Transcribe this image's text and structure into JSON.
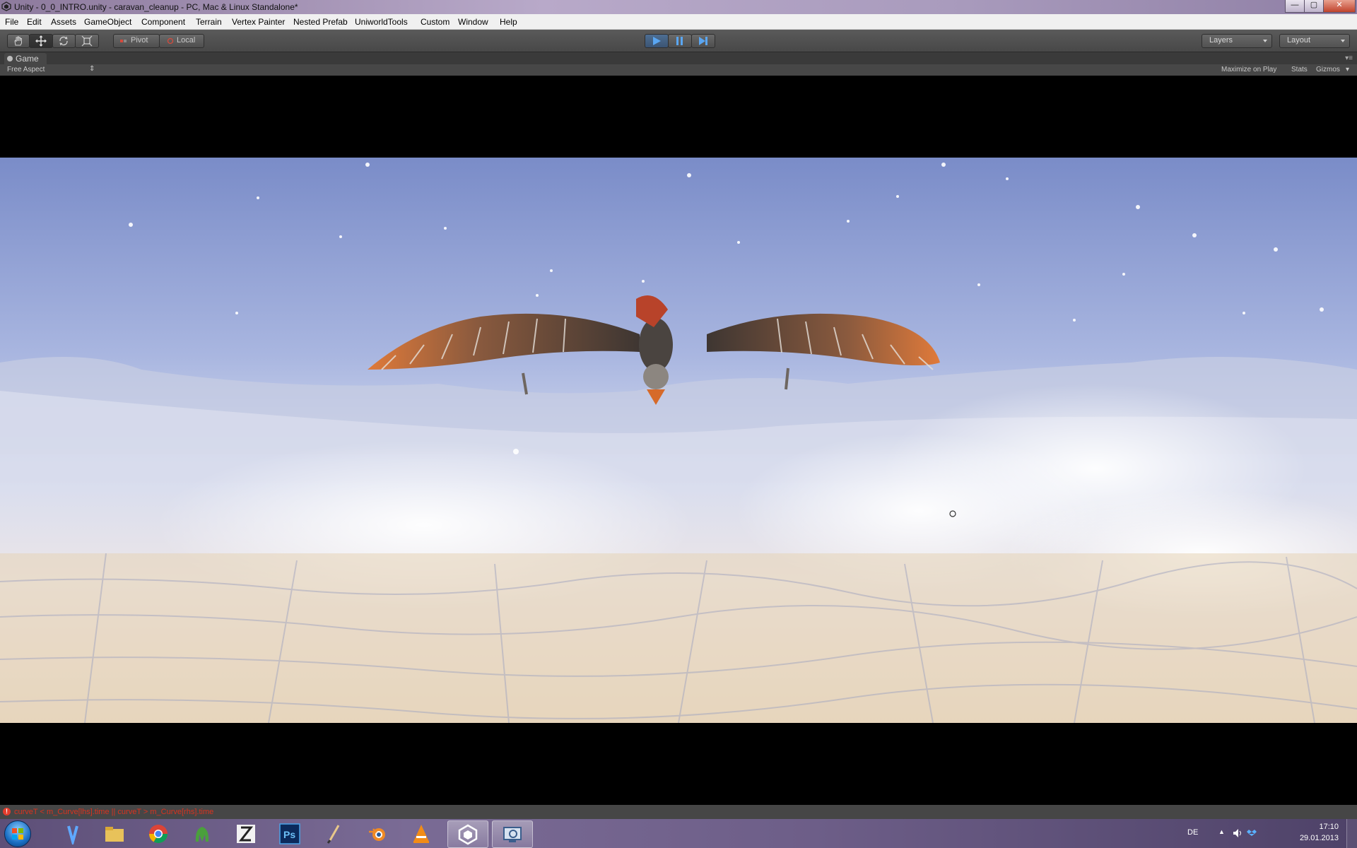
{
  "window": {
    "title": "Unity - 0_0_INTRO.unity - caravan_cleanup - PC, Mac & Linux Standalone*"
  },
  "menu": [
    "File",
    "Edit",
    "Assets",
    "GameObject",
    "Component",
    "Terrain",
    "Vertex Painter",
    "Nested Prefab",
    "UniworldTools",
    "Custom",
    "Window",
    "Help"
  ],
  "toolbar": {
    "pivot_label": "Pivot",
    "local_label": "Local",
    "layers_label": "Layers",
    "layout_label": "Layout"
  },
  "game_panel": {
    "tab_label": "Game",
    "aspect_label": "Free Aspect",
    "maximize_label": "Maximize on Play",
    "stats_label": "Stats",
    "gizmos_label": "Gizmos"
  },
  "status": {
    "error_text": "curveT < m_Curve[lhs].time || curveT > m_Curve[rhs].time"
  },
  "taskbar": {
    "language": "DE",
    "time": "17:10",
    "date": "29.01.2013"
  },
  "colors": {
    "accent_play": "#4d8fd8",
    "error": "#d9331f",
    "editor_dark": "#474747"
  },
  "icons": [
    "unity-icon",
    "hand-tool-icon",
    "move-tool-icon",
    "rotate-tool-icon",
    "scale-tool-icon",
    "play-icon",
    "pause-icon",
    "step-icon",
    "windows-start-icon"
  ]
}
